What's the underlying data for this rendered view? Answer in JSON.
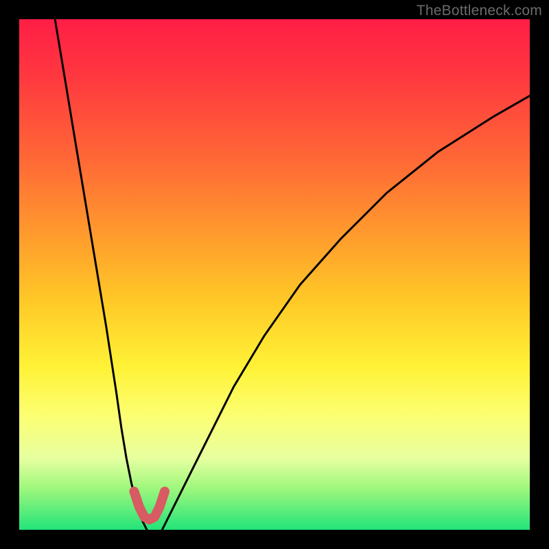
{
  "watermark": "TheBottleneck.com",
  "chart_data": {
    "type": "line",
    "title": "",
    "xlabel": "",
    "ylabel": "",
    "xlim": [
      0,
      100
    ],
    "ylim": [
      0,
      100
    ],
    "series": [
      {
        "name": "left-curve",
        "x": [
          7,
          9,
          11,
          13,
          15,
          17,
          19,
          20,
          21,
          22,
          23,
          24,
          25
        ],
        "y": [
          100,
          88,
          76,
          64,
          52,
          40,
          27,
          20,
          14,
          9,
          5,
          2,
          0
        ]
      },
      {
        "name": "right-curve",
        "x": [
          28,
          30,
          33,
          37,
          42,
          48,
          55,
          63,
          72,
          82,
          93,
          100
        ],
        "y": [
          0,
          4,
          10,
          18,
          28,
          38,
          48,
          57,
          66,
          74,
          81,
          85
        ]
      },
      {
        "name": "valley-mark",
        "x": [
          22.5,
          23.5,
          24.5,
          25.5,
          26.5,
          27.5,
          28.5
        ],
        "y": [
          7.5,
          4.5,
          2.5,
          2.0,
          2.5,
          4.5,
          7.5
        ]
      }
    ],
    "colors": {
      "curve_stroke": "#000000",
      "valley_stroke": "#d85a63"
    }
  }
}
